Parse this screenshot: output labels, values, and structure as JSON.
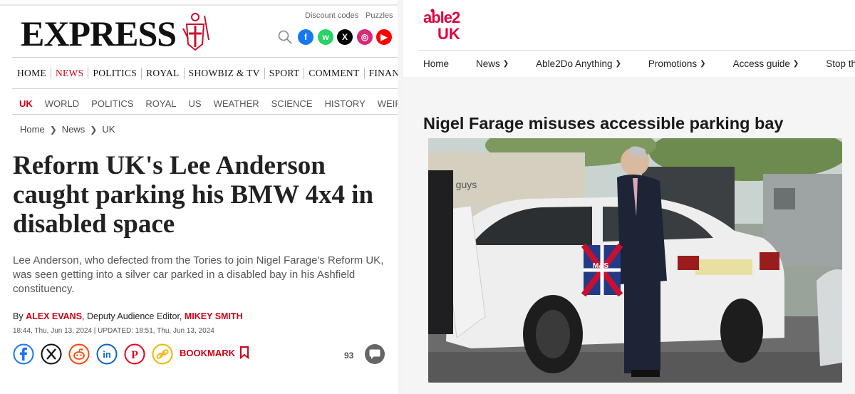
{
  "express": {
    "utility_links": [
      "Discount codes",
      "Puzzles"
    ],
    "logo": "EXPRESS",
    "social": [
      {
        "name": "facebook",
        "color": "#1877f2",
        "glyph": "f"
      },
      {
        "name": "whatsapp",
        "color": "#25d366",
        "glyph": "w"
      },
      {
        "name": "x",
        "color": "#000000",
        "glyph": "X"
      },
      {
        "name": "instagram",
        "color": "#d62976",
        "glyph": "◎"
      },
      {
        "name": "youtube",
        "color": "#ff0000",
        "glyph": "▶"
      }
    ],
    "main_nav": [
      "HOME",
      "NEWS",
      "POLITICS",
      "ROYAL",
      "SHOWBIZ & TV",
      "SPORT",
      "COMMENT",
      "FINAN"
    ],
    "main_nav_active": "NEWS",
    "sub_nav": [
      "UK",
      "WORLD",
      "POLITICS",
      "ROYAL",
      "US",
      "WEATHER",
      "SCIENCE",
      "HISTORY",
      "WEIRD"
    ],
    "sub_nav_active": "UK",
    "breadcrumb": [
      "Home",
      "News",
      "UK"
    ],
    "headline": "Reform UK's Lee Anderson caught parking his BMW 4x4 in disabled space",
    "standfirst": "Lee Anderson, who defected from the Tories to join Nigel Farage's Reform UK, was seen getting into a silver car parked in a disabled bay in his Ashfield constituency.",
    "byline": {
      "prefix": "By",
      "author1": "ALEX EVANS",
      "role": ", Deputy Audience Editor, ",
      "author2": "MIKEY SMITH"
    },
    "dateline": "18:44, Thu, Jun 13, 2024 | UPDATED: 18:51, Thu, Jun 13, 2024",
    "share_icons": [
      {
        "name": "facebook",
        "color": "#1877f2",
        "glyph": "f"
      },
      {
        "name": "x",
        "color": "#000000",
        "glyph": "X"
      },
      {
        "name": "reddit",
        "color": "#ff4500",
        "glyph": "●"
      },
      {
        "name": "linkedin",
        "color": "#0a66c2",
        "glyph": "in"
      },
      {
        "name": "pinterest",
        "color": "#e60023",
        "glyph": "P"
      },
      {
        "name": "link",
        "color": "#f2b300",
        "glyph": "∞"
      }
    ],
    "bookmark_label": "BOOKMARK",
    "comment_count": "93",
    "accent": "#d10014"
  },
  "able2": {
    "logo_top": "able2",
    "logo_bottom": "UK",
    "brand_color": "#e0003c",
    "nav": [
      {
        "label": "Home",
        "dropdown": false
      },
      {
        "label": "News",
        "dropdown": true
      },
      {
        "label": "Able2Do Anything",
        "dropdown": true
      },
      {
        "label": "Promotions",
        "dropdown": true
      },
      {
        "label": "Access guide",
        "dropdown": true
      },
      {
        "label": "Stop th",
        "dropdown": false
      }
    ],
    "title": "Nigel Farage misuses accessible parking bay",
    "photo": {
      "bag_text": "M&S",
      "van_text": "ce guys"
    }
  }
}
